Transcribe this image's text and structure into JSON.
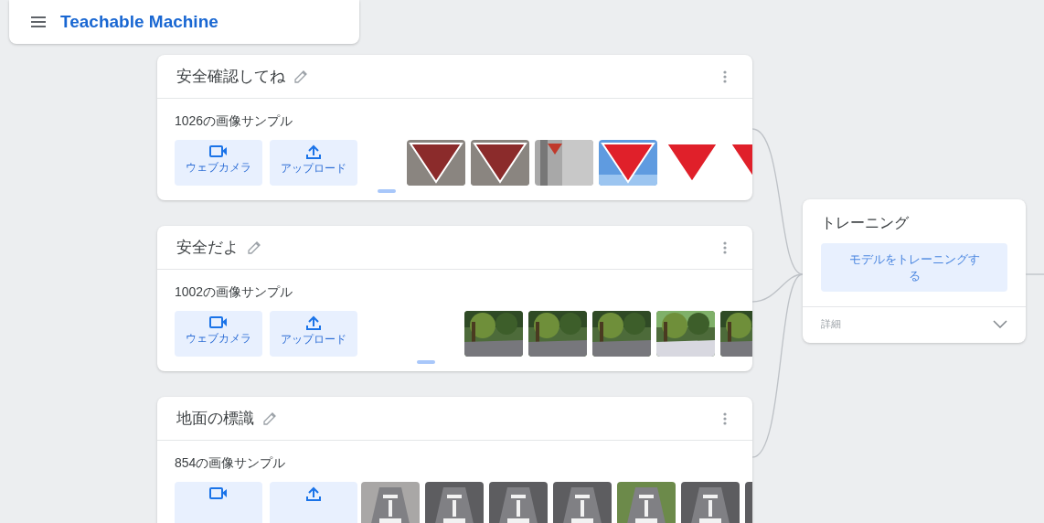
{
  "header": {
    "title": "Teachable Machine"
  },
  "classes": [
    {
      "name": "安全確認してね",
      "samples": "1026の画像サンプル",
      "buttons": [
        {
          "kind": "webcam",
          "label": "ウェブカメラ"
        },
        {
          "kind": "upload",
          "label": "アップロード"
        }
      ],
      "thumbnails": [
        {
          "kind": "picture"
        },
        {
          "kind": "picture"
        },
        {
          "kind": "picture"
        },
        {
          "kind": "picture"
        },
        {
          "kind": "picture"
        },
        {
          "kind": "picture"
        }
      ]
    },
    {
      "name": "安全だよ",
      "samples": "1002の画像サンプル",
      "buttons": [
        {
          "kind": "webcam",
          "label": "ウェブカメラ"
        },
        {
          "kind": "upload",
          "label": "アップロード"
        }
      ],
      "thumbnails": [
        {
          "kind": "picture"
        },
        {
          "kind": "picture"
        },
        {
          "kind": "picture"
        },
        {
          "kind": "picture"
        },
        {
          "kind": "picture"
        }
      ]
    },
    {
      "name": "地面の標識",
      "samples": "854の画像サンプル",
      "buttons": [
        {
          "kind": "webcam"
        },
        {
          "kind": "upload"
        }
      ],
      "thumbnails": [
        {
          "kind": "picture"
        },
        {
          "kind": "picture"
        },
        {
          "kind": "picture"
        },
        {
          "kind": "picture"
        },
        {
          "kind": "picture"
        },
        {
          "kind": "picture"
        },
        {
          "kind": "picture"
        }
      ]
    }
  ],
  "training": {
    "title": "トレーニング",
    "button": "モデルをトレーニングする",
    "details": "詳細",
    "expanded": false
  }
}
